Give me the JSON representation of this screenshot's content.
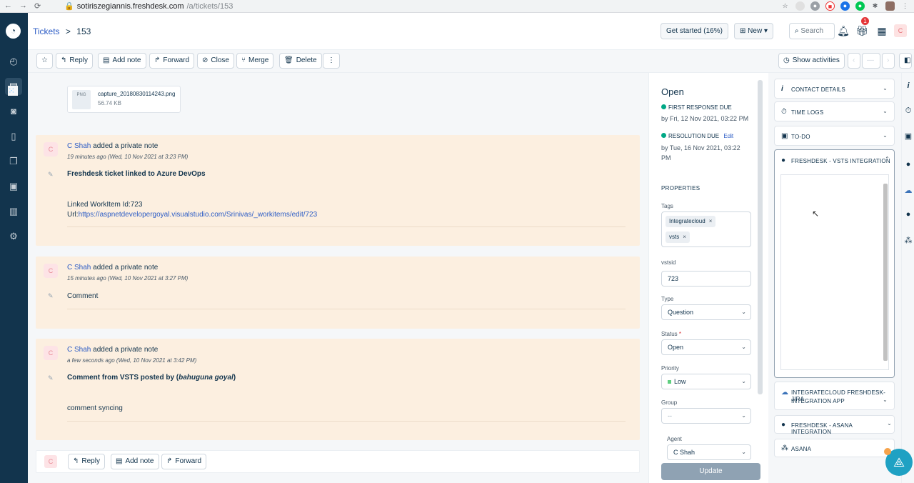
{
  "browser": {
    "url_host": "sotiriszegiannis.freshdesk.com",
    "url_path": "/a/tickets/153"
  },
  "header": {
    "breadcrumb_root": "Tickets",
    "breadcrumb_sep": ">",
    "ticket_id": "153",
    "get_started": "Get started (16%)",
    "new_label": "New",
    "search_placeholder": "Search",
    "notification_count": "1",
    "avatar_initial": "C"
  },
  "toolbar": {
    "reply": "Reply",
    "add_note": "Add note",
    "forward": "Forward",
    "close": "Close",
    "merge": "Merge",
    "delete": "Delete",
    "more": "⋮",
    "show_activities": "Show activities"
  },
  "attachment": {
    "file_name": "capture_20180830114243.png",
    "file_size": "56.74 KB",
    "thumb_label": "PNG"
  },
  "notes": [
    {
      "avatar": "C",
      "author": "C Shah",
      "action": "added a private note",
      "time": "19 minutes ago (Wed, 10 Nov 2021 at 3:23 PM)",
      "title": "Freshdesk ticket linked to Azure DevOps",
      "body1": "Linked WorkItem Id:723",
      "url_prefix": "Url:",
      "url": "https://aspnetdevelopergoyal.visualstudio.com/Srinivas/_workitems/edit/723"
    },
    {
      "avatar": "C",
      "author": "C Shah",
      "action": "added a private note",
      "time": "15 minutes ago (Wed, 10 Nov 2021 at 3:27 PM)",
      "body1": "Comment"
    },
    {
      "avatar": "C",
      "author": "C Shah",
      "action": "added a private note",
      "time": "a few seconds ago (Wed, 10 Nov 2021 at 3:42 PM)",
      "title_prefix": "Comment from VSTS posted by (",
      "title_name": "bahuguna goyal",
      "title_suffix": ")",
      "body1": "comment syncing"
    }
  ],
  "replybar": {
    "avatar": "C",
    "reply": "Reply",
    "add_note": "Add note",
    "forward": "Forward"
  },
  "properties": {
    "status_title": "Open",
    "first_response_label": "FIRST RESPONSE DUE",
    "first_response_value": "by Fri, 12 Nov 2021, 03:22 PM",
    "resolution_label": "RESOLUTION DUE",
    "resolution_edit": "Edit",
    "resolution_value_1": "by Tue, 16 Nov 2021, 03:22",
    "resolution_value_2": "PM",
    "section": "PROPERTIES",
    "tags_label": "Tags",
    "tags": [
      "Integratecloud",
      "vsts"
    ],
    "vstsid_label": "vstsid",
    "vstsid_value": "723",
    "type_label": "Type",
    "type_value": "Question",
    "status_label": "Status",
    "status_required": "*",
    "status_value": "Open",
    "priority_label": "Priority",
    "priority_value": "Low",
    "group_label": "Group",
    "group_value": "--",
    "agent_label": "Agent",
    "agent_value": "C Shah",
    "update": "Update"
  },
  "apps": {
    "contact_details": "CONTACT DETAILS",
    "time_logs": "TIME LOGS",
    "todo": "TO-DO",
    "vsts": "FRESHDESK - VSTS INTEGRATION",
    "jira_1": "INTEGRATECLOUD FRESHDESK-JIRA",
    "jira_2": "INTEGRATION APP",
    "asana_integration": "FRESHDESK - ASANA INTEGRATION",
    "asana": "ASANA"
  },
  "colors": {
    "sidebar": "#12344d",
    "note_bg": "#fcefe0",
    "link": "#2c5cc5",
    "sla_green": "#00a886",
    "priority_low": "#5fcf80"
  }
}
